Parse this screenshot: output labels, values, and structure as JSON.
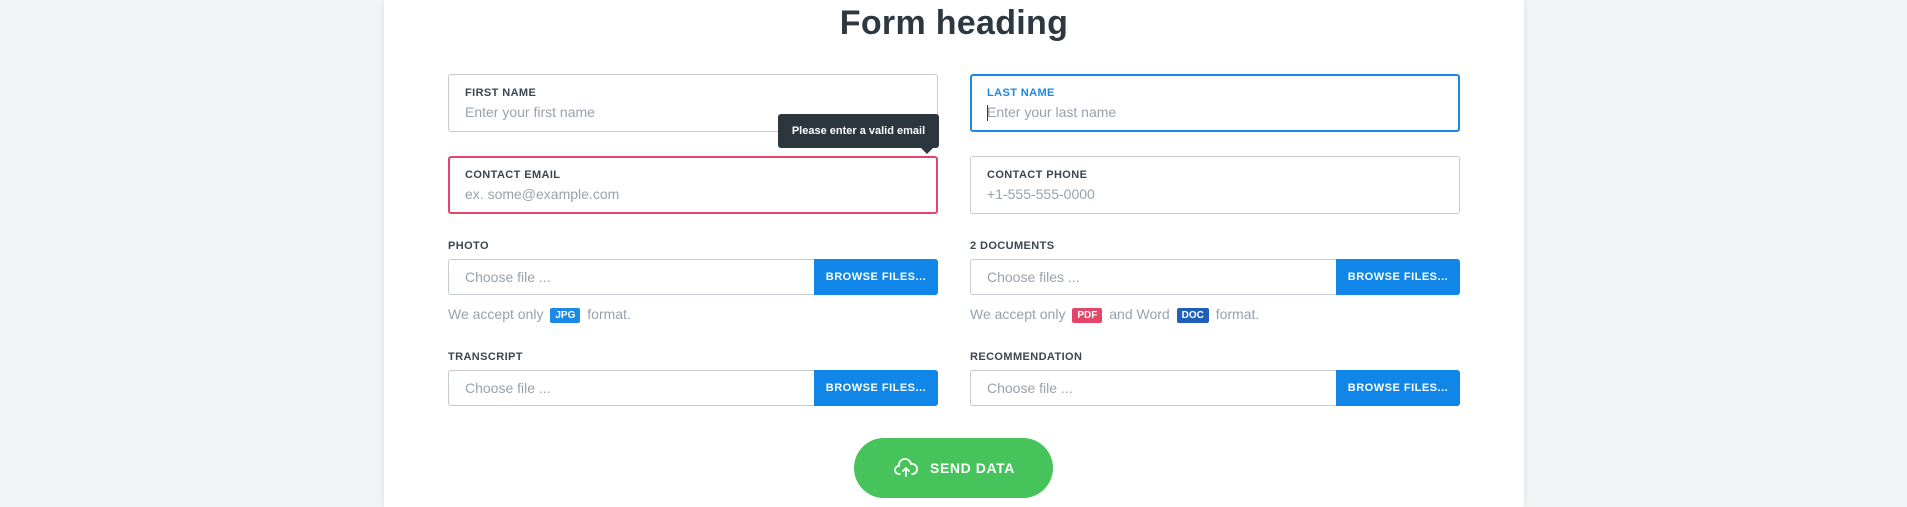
{
  "form": {
    "heading": "Form heading",
    "fields": {
      "first_name": {
        "label": "FIRST NAME",
        "value": "",
        "placeholder": "Enter your first name"
      },
      "last_name": {
        "label": "LAST NAME",
        "value": "",
        "placeholder": "Enter your last name"
      },
      "contact_email": {
        "label": "CONTACT EMAIL",
        "value": "",
        "placeholder": "ex. some@example.com"
      },
      "contact_phone": {
        "label": "CONTACT PHONE",
        "value": "",
        "placeholder": "+1-555-555-0000"
      }
    },
    "tooltip": "Please enter a valid email",
    "uploads": {
      "photo": {
        "label": "PHOTO",
        "placeholder": "Choose file ...",
        "button": "BROWSE FILES...",
        "hint_prefix": "We accept only",
        "badge": "JPG",
        "hint_suffix": "format."
      },
      "documents": {
        "label": "2 DOCUMENTS",
        "placeholder": "Choose files ...",
        "button": "BROWSE FILES...",
        "hint_prefix": "We accept only",
        "badge1": "PDF",
        "hint_middle": "and Word",
        "badge2": "DOC",
        "hint_suffix": "format."
      },
      "transcript": {
        "label": "TRANSCRIPT",
        "placeholder": "Choose file ...",
        "button": "BROWSE FILES..."
      },
      "recommendation": {
        "label": "RECOMMENDATION",
        "placeholder": "Choose file ...",
        "button": "BROWSE FILES..."
      }
    },
    "submit": {
      "label": "SEND DATA",
      "icon": "cloud-upload-icon"
    }
  },
  "colors": {
    "accent_blue": "#0f86e8",
    "focus_blue": "#1a8ae6",
    "error_red": "#e6456a",
    "success_green": "#46c35a",
    "badge_jpg": "#1a8ae6",
    "badge_pdf": "#e6456a",
    "badge_doc": "#1f5fb8",
    "tooltip_bg": "#2c363e"
  }
}
